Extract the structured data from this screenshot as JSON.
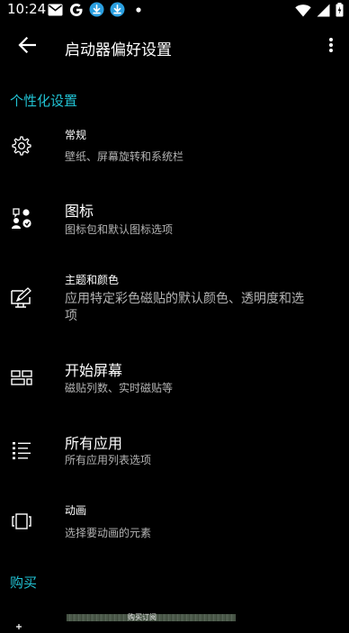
{
  "status_bar": {
    "time": "10:24",
    "left_icons": [
      "gmail-icon",
      "google-icon",
      "download-icon",
      "download-icon",
      "dot-icon"
    ],
    "right_icons": [
      "wifi-icon",
      "signal-icon",
      "battery-icon"
    ]
  },
  "toolbar": {
    "title": "启动器偏好设置",
    "back_icon": "arrow-back-icon",
    "more_icon": "more-vert-icon"
  },
  "sections": {
    "personalization": "个性化设置",
    "purchase": "购买"
  },
  "items": [
    {
      "icon": "gear-icon",
      "title": "常规",
      "summary": "壁纸、屏幕旋转和系统栏"
    },
    {
      "icon": "icon-pack-icon",
      "title": "图标",
      "summary": "图标包和默认图标选项"
    },
    {
      "icon": "theme-edit-icon",
      "title": "主题和颜色",
      "summary": "应用特定彩色磁贴的默认颜色、透明度和选项"
    },
    {
      "icon": "start-screen-icon",
      "title": "开始屏幕",
      "summary": "磁贴列数、实时磁贴等"
    },
    {
      "icon": "list-icon",
      "title": "所有应用",
      "summary": "所有应用列表选项"
    },
    {
      "icon": "animation-icon",
      "title": "动画",
      "summary": "选择要动画的元素"
    }
  ],
  "partial_bottom_text": "购买订阅",
  "colors": {
    "accent": "#21c2d3",
    "background": "#000000",
    "summary": "#b3b3b3"
  }
}
